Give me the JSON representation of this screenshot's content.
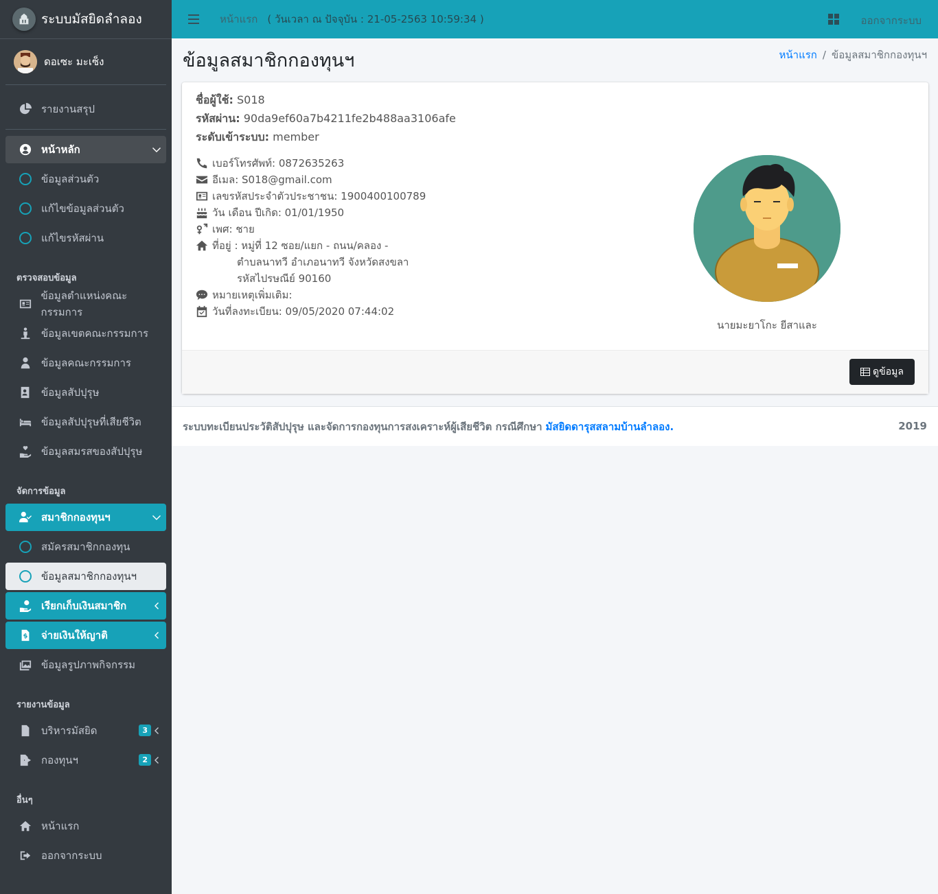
{
  "brand": {
    "title": "ระบบมัสยิดลำลอง"
  },
  "user": {
    "name": "ดอเซะ มะเซ็ง"
  },
  "sidebar": {
    "report_summary": "รายงานสรุป",
    "home_section": {
      "label": "หน้าหลัก",
      "items": [
        "ข้อมูลส่วนตัว",
        "แก้ไขข้อมูลส่วนตัว",
        "แก้ไขรหัสผ่าน"
      ]
    },
    "check_header": "ตรวจสอบข้อมูล",
    "check_items": [
      "ข้อมูลตำแหน่งคณะกรรมการ",
      "ข้อมูลเขตคณะกรรมการ",
      "ข้อมูลคณะกรรมการ",
      "ข้อมูลสัปปุรุษ",
      "ข้อมูลสัปปุรุษที่เสียชีวิต",
      "ข้อมูลสมรสของสัปปุรุษ"
    ],
    "manage_header": "จัดการข้อมูล",
    "fund_members": {
      "label": "สมาชิกกองทุนฯ",
      "items": [
        "สมัครสมาชิกกองทุน",
        "ข้อมูลสมาชิกกองทุนฯ"
      ]
    },
    "collect_money": "เรียกเก็บเงินสมาชิก",
    "pay_relatives": "จ่ายเงินให้ญาติ",
    "activity_photos": "ข้อมูลรูปภาพกิจกรรม",
    "report_header": "รายงานข้อมูล",
    "mosque_admin": {
      "label": "บริหารมัสยิด",
      "badge": "3"
    },
    "fund": {
      "label": "กองทุนฯ",
      "badge": "2"
    },
    "other_header": "อื่นๆ",
    "home": "หน้าแรก",
    "logout": "ออกจากระบบ"
  },
  "topbar": {
    "home_link": "หน้าแรก",
    "datetime": "( วันเวลา ณ ปัจจุบัน : 21-05-2563 10:59:34 )",
    "logout": "ออกจากระบบ"
  },
  "page": {
    "title": "ข้อมูลสมาชิกกองทุนฯ",
    "breadcrumb_home": "หน้าแรก",
    "breadcrumb_sep": "/",
    "breadcrumb_current": "ข้อมูลสมาชิกกองทุนฯ"
  },
  "member": {
    "username_label": "ชื่อผู้ใช้:",
    "username": "S018",
    "password_label": "รหัสผ่าน:",
    "password": "90da9ef60a7b4211fe2b488aa3106afe",
    "level_label": "ระดับเข้าระบบ:",
    "level": "member",
    "phone": "เบอร์โทรศัพท์: 0872635263",
    "email": "อีเมล: S018@gmail.com",
    "citizen_id": "เลขรหัสประจำตัวประชาชน: 1900400100789",
    "birthdate": "วัน เดือน ปีเกิด: 01/01/1950",
    "gender": "เพศ: ชาย",
    "address_line1": "ที่อยู่ : หมู่ที่ 12 ซอย/แยก - ถนน/คลอง -",
    "address_line2": "ตำบลนาทวี อำเภอนาทวี จังหวัดสงขลา",
    "address_line3": "รหัสไปรษณีย์ 90160",
    "note": "หมายเหตุเพิ่มเติม:",
    "registered": "วันที่ลงทะเบียน: 09/05/2020 07:44:02",
    "full_name": "นายมะยาโกะ ยีสาและ",
    "view_button": "ดูข้อมูล"
  },
  "footer": {
    "text": "ระบบทะเบียนประวัติสัปปุรุษ และจัดการกองทุนการสงเคราะห์ผู้เสียชีวิต กรณีศึกษา",
    "link": "มัสยิดดารุสสลามบ้านลำลอง.",
    "year": "2019"
  },
  "colors": {
    "accent": "#17a2b8",
    "sidebar": "#343a40",
    "link": "#007bff"
  }
}
